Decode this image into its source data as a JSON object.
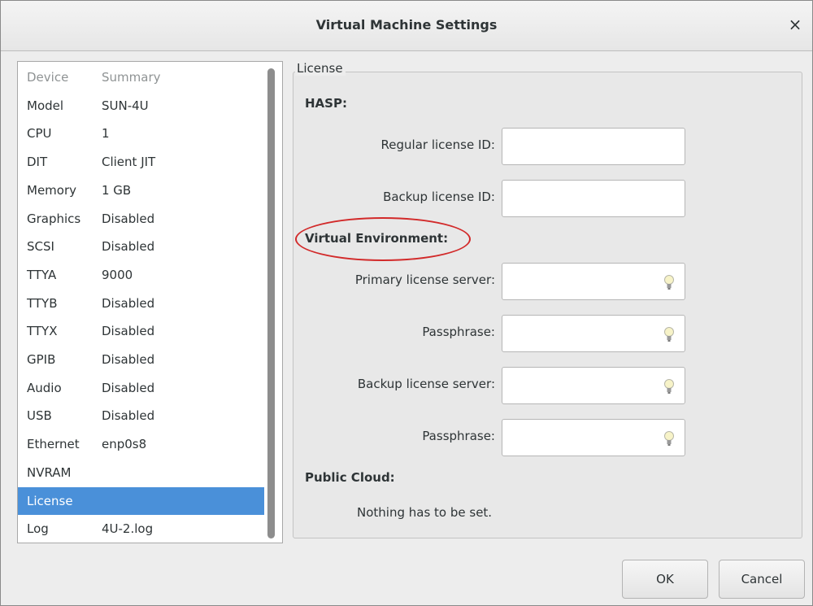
{
  "window": {
    "title": "Virtual Machine Settings",
    "close_glyph": "×"
  },
  "devices": {
    "header": {
      "device": "Device",
      "summary": "Summary"
    },
    "rows": [
      {
        "device": "Model",
        "summary": "SUN-4U"
      },
      {
        "device": "CPU",
        "summary": "1"
      },
      {
        "device": "DIT",
        "summary": "Client JIT"
      },
      {
        "device": "Memory",
        "summary": "1 GB"
      },
      {
        "device": "Graphics",
        "summary": "Disabled"
      },
      {
        "device": "SCSI",
        "summary": "Disabled"
      },
      {
        "device": "TTYA",
        "summary": "9000"
      },
      {
        "device": "TTYB",
        "summary": "Disabled"
      },
      {
        "device": "TTYX",
        "summary": "Disabled"
      },
      {
        "device": "GPIB",
        "summary": "Disabled"
      },
      {
        "device": "Audio",
        "summary": "Disabled"
      },
      {
        "device": "USB",
        "summary": "Disabled"
      },
      {
        "device": "Ethernet",
        "summary": "enp0s8"
      },
      {
        "device": "NVRAM",
        "summary": ""
      },
      {
        "device": "License",
        "summary": ""
      },
      {
        "device": "Log",
        "summary": "4U-2.log"
      }
    ],
    "selected": "License"
  },
  "license": {
    "group_title": "License",
    "hasp": {
      "title": "HASP:",
      "regular_label": "Regular license ID:",
      "regular_value": "",
      "backup_label": "Backup license ID:",
      "backup_value": ""
    },
    "virtual_env": {
      "title": "Virtual Environment:",
      "primary_label": "Primary license server:",
      "primary_value": "",
      "passphrase1_label": "Passphrase:",
      "passphrase1_value": "",
      "backup_label": "Backup license server:",
      "backup_value": "",
      "passphrase2_label": "Passphrase:",
      "passphrase2_value": ""
    },
    "public_cloud": {
      "title": "Public Cloud:",
      "note": "Nothing has to be set."
    }
  },
  "buttons": {
    "ok": "OK",
    "cancel": "Cancel"
  },
  "colors": {
    "selection": "#4a90d9",
    "highlight_oval": "#d22a2a"
  },
  "icons": {
    "field_hint": "lightbulb-icon",
    "close": "close-icon"
  }
}
